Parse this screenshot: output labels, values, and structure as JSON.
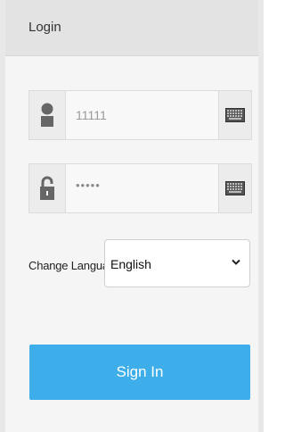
{
  "header": {
    "title": "Login"
  },
  "username": {
    "value": "11111",
    "icon": "user-icon",
    "keyboard_icon": "keyboard-icon"
  },
  "password": {
    "value": "•••••",
    "icon": "lock-icon",
    "keyboard_icon": "keyboard-icon"
  },
  "language": {
    "label": "Change Language",
    "selected": "English",
    "icon": "chevron-down-icon"
  },
  "signin": {
    "label": "Sign In"
  },
  "colors": {
    "accent": "#3daee9",
    "header_bg": "#e3e3e3",
    "panel_bg": "#f5f5f5"
  }
}
